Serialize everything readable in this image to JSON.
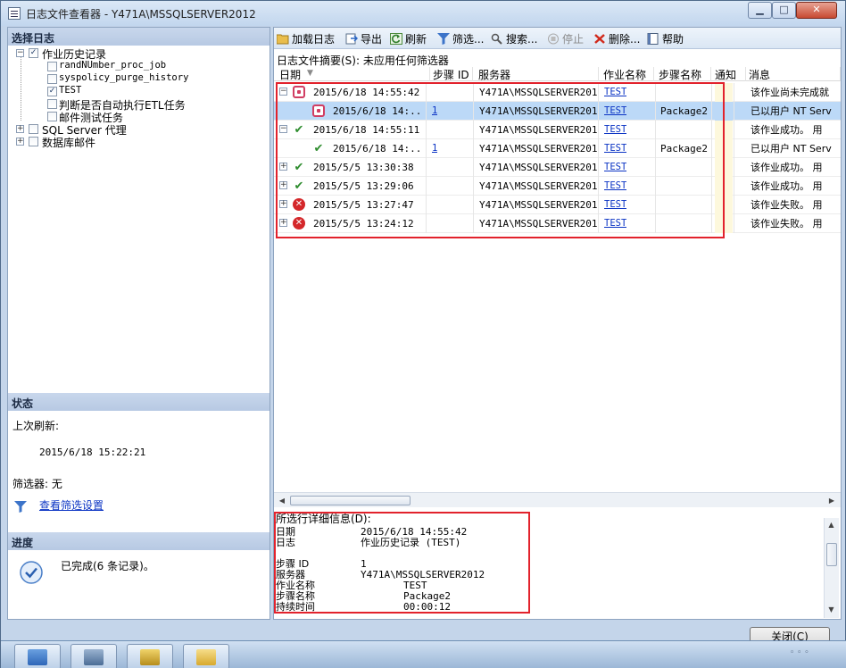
{
  "window": {
    "title": "日志文件查看器 - Y471A\\MSSQLSERVER2012"
  },
  "left_panel": {
    "select_log_title": "选择日志",
    "tree": [
      {
        "label": "作业历史记录",
        "checked": true,
        "expanded": true,
        "level": 0
      },
      {
        "label": "randNUmber_proc_job",
        "checked": false,
        "level": 1
      },
      {
        "label": "syspolicy_purge_history",
        "checked": false,
        "level": 1
      },
      {
        "label": "TEST",
        "checked": true,
        "level": 1
      },
      {
        "label": "判断是否自动执行ETL任务",
        "checked": false,
        "level": 1
      },
      {
        "label": "邮件测试任务",
        "checked": false,
        "level": 1
      },
      {
        "label": "SQL Server 代理",
        "checked": false,
        "expanded": false,
        "level": 0
      },
      {
        "label": "数据库邮件",
        "checked": false,
        "expanded": false,
        "level": 0
      }
    ],
    "status_title": "状态",
    "last_refresh_label": "上次刷新:",
    "last_refresh_value": "2015/6/18 15:22:21",
    "filter_label": "筛选器: 无",
    "view_filter_link": "查看筛选设置",
    "progress_title": "进度",
    "progress_text": "已完成(6 条记录)。"
  },
  "toolbar": {
    "load_log": "加载日志",
    "export": "导出",
    "refresh": "刷新",
    "filter": "筛选...",
    "search": "搜索...",
    "stop": "停止",
    "delete": "删除...",
    "help": "帮助"
  },
  "summary": "日志文件摘要(S): 未应用任何筛选器",
  "grid": {
    "columns": [
      "日期",
      "步骤 ID",
      "服务器",
      "作业名称",
      "步骤名称",
      "通知",
      "消息"
    ],
    "rows": [
      {
        "expander": "−",
        "status": "stop",
        "date": "2015/6/18 14:55:42",
        "step": "",
        "server": "Y471A\\MSSQLSERVER2012",
        "job": "TEST",
        "stepname": "",
        "message": "该作业尚未完成就",
        "selected": false,
        "child": false
      },
      {
        "expander": "",
        "status": "stop",
        "date": "2015/6/18 14:...",
        "step": "1",
        "server": "Y471A\\MSSQLSERVER2012",
        "job": "TEST",
        "stepname": "Package2",
        "message": "已以用户 NT Serv",
        "selected": true,
        "child": true
      },
      {
        "expander": "−",
        "status": "ok",
        "date": "2015/6/18 14:55:11",
        "step": "",
        "server": "Y471A\\MSSQLSERVER2012",
        "job": "TEST",
        "stepname": "",
        "message": "该作业成功。  用",
        "selected": false,
        "child": false
      },
      {
        "expander": "",
        "status": "ok",
        "date": "2015/6/18 14:...",
        "step": "1",
        "server": "Y471A\\MSSQLSERVER2012",
        "job": "TEST",
        "stepname": "Package2",
        "message": "已以用户 NT Serv",
        "selected": false,
        "child": true
      },
      {
        "expander": "+",
        "status": "ok",
        "date": "2015/5/5 13:30:38",
        "step": "",
        "server": "Y471A\\MSSQLSERVER2012",
        "job": "TEST",
        "stepname": "",
        "message": "该作业成功。  用",
        "selected": false,
        "child": false
      },
      {
        "expander": "+",
        "status": "ok",
        "date": "2015/5/5 13:29:06",
        "step": "",
        "server": "Y471A\\MSSQLSERVER2012",
        "job": "TEST",
        "stepname": "",
        "message": "该作业成功。  用",
        "selected": false,
        "child": false
      },
      {
        "expander": "+",
        "status": "err",
        "date": "2015/5/5 13:27:47",
        "step": "",
        "server": "Y471A\\MSSQLSERVER2012",
        "job": "TEST",
        "stepname": "",
        "message": "该作业失败。  用",
        "selected": false,
        "child": false
      },
      {
        "expander": "+",
        "status": "err",
        "date": "2015/5/5 13:24:12",
        "step": "",
        "server": "Y471A\\MSSQLSERVER2012",
        "job": "TEST",
        "stepname": "",
        "message": "该作业失败。  用",
        "selected": false,
        "child": false
      }
    ]
  },
  "details": {
    "title": "所选行详细信息(D):",
    "rows": [
      {
        "label": "日期",
        "value": "2015/6/18 14:55:42"
      },
      {
        "label": "日志",
        "value": "作业历史记录 (TEST)"
      },
      {
        "label": "",
        "value": ""
      },
      {
        "label": "步骤 ID",
        "value": "1"
      },
      {
        "label": "服务器",
        "value": "Y471A\\MSSQLSERVER2012"
      },
      {
        "label": "作业名称",
        "value": "TEST"
      },
      {
        "label": "步骤名称",
        "value": "Package2"
      },
      {
        "label": "持续时间",
        "value": "00:00:12"
      }
    ]
  },
  "close_button": "关闭(C)",
  "colors": {
    "highlight_box": "#e2222c",
    "selected_row": "#bcd9f7",
    "link": "#0b34c4",
    "error": "#d4272a",
    "success": "#2f8d2f"
  }
}
